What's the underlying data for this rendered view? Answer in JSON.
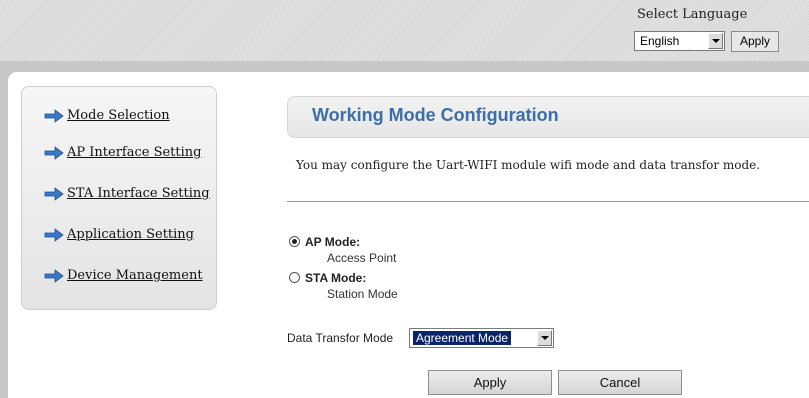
{
  "header": {
    "language_label": "Select Language",
    "language_selected": "English",
    "apply_label": "Apply"
  },
  "sidebar": {
    "items": [
      {
        "label": "Mode Selection"
      },
      {
        "label": "AP Interface Setting"
      },
      {
        "label": "STA Interface Setting"
      },
      {
        "label": "Application Setting"
      },
      {
        "label": "Device Management"
      }
    ]
  },
  "main": {
    "title": "Working Mode Configuration",
    "description": "You may configure the Uart-WIFI module wifi mode and data transfor mode.",
    "modes": [
      {
        "label": "AP Mode:",
        "sub": "Access Point",
        "checked": true
      },
      {
        "label": "STA Mode:",
        "sub": "Station Mode",
        "checked": false
      }
    ],
    "data_transfer": {
      "label": "Data Transfor Mode",
      "selected": "Agreement Mode"
    },
    "buttons": {
      "apply": "Apply",
      "cancel": "Cancel"
    }
  },
  "colors": {
    "title_blue": "#3d6ea7",
    "arrow_blue": "#3a78c8",
    "selection_blue": "#0a246a"
  },
  "icons": {
    "nav_arrow": "arrow-right-icon"
  }
}
